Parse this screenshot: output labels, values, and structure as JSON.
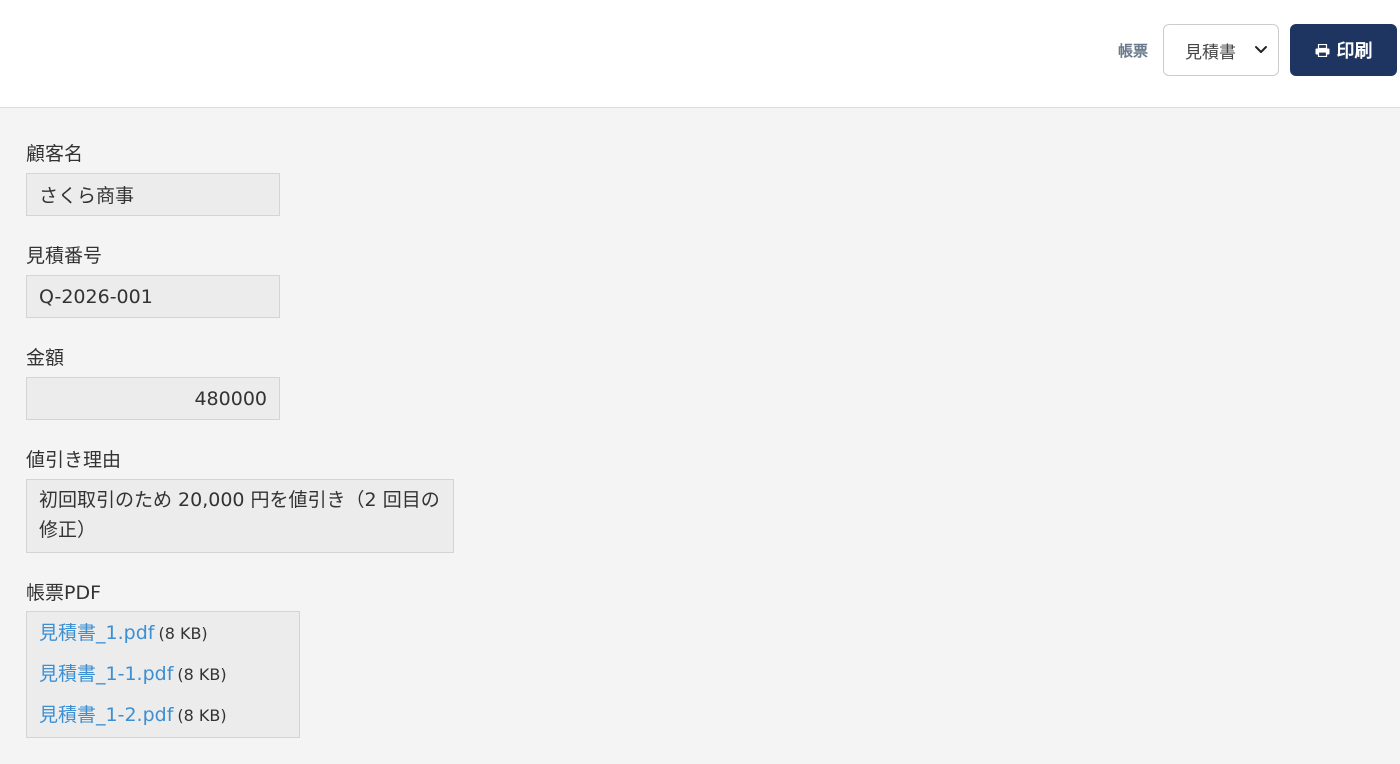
{
  "header": {
    "form_label": "帳票",
    "form_select": {
      "selected": "見積書",
      "options": [
        "見積書"
      ]
    },
    "print_button": {
      "label": "印刷",
      "icon": "printer-icon"
    }
  },
  "fields": {
    "customer_name": {
      "label": "顧客名",
      "value": "さくら商事"
    },
    "quote_number": {
      "label": "見積番号",
      "value": "Q-2026-001"
    },
    "amount": {
      "label": "金額",
      "value": "480000"
    },
    "discount_reason": {
      "label": "値引き理由",
      "value": "初回取引のため 20,000 円を値引き（2 回目の修正）"
    },
    "pdf": {
      "label": "帳票PDF",
      "files": [
        {
          "name": "見積書_1.pdf",
          "size": "(8 KB)"
        },
        {
          "name": "見積書_1-1.pdf",
          "size": "(8 KB)"
        },
        {
          "name": "見積書_1-2.pdf",
          "size": "(8 KB)"
        }
      ]
    }
  },
  "colors": {
    "accent": "#1e3461",
    "link": "#3c8fd3",
    "page_bg": "#f4f4f4",
    "field_bg": "#ececec"
  }
}
